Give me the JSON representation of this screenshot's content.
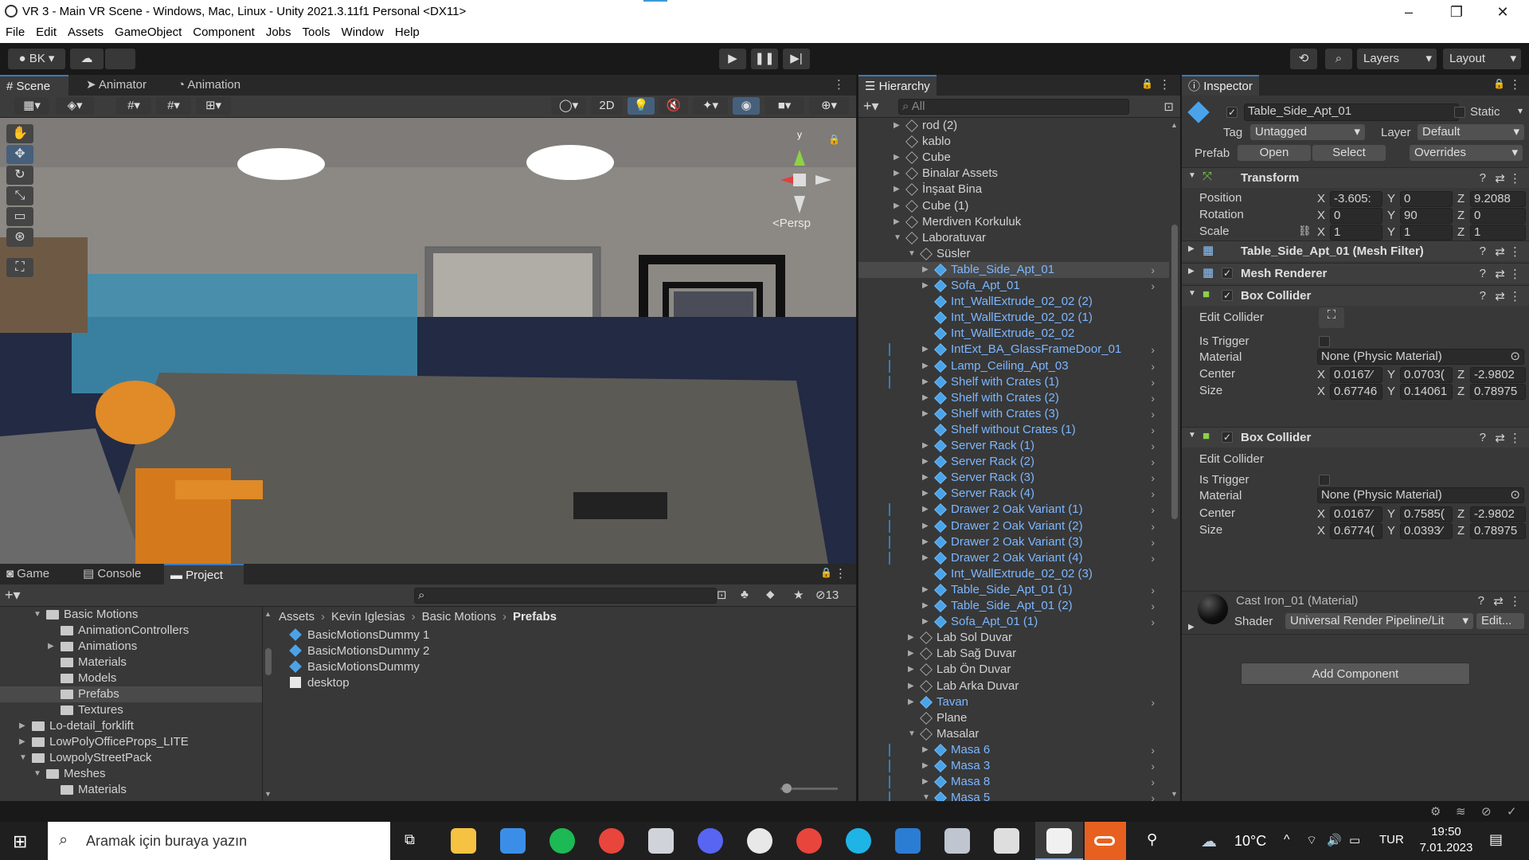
{
  "window": {
    "title": "VR 3 - Main VR Scene - Windows, Mac, Linux - Unity 2021.3.11f1 Personal <DX11>"
  },
  "menu": [
    "File",
    "Edit",
    "Assets",
    "GameObject",
    "Component",
    "Jobs",
    "Tools",
    "Window",
    "Help"
  ],
  "toolbar": {
    "account": "BK",
    "layers": "Layers",
    "layout": "Layout"
  },
  "scene_panel": {
    "tabs": [
      "Scene",
      "Animator",
      "Animation"
    ],
    "mode_2d": "2D",
    "persp_label": "<Persp",
    "gizmo_y": "y"
  },
  "hierarchy": {
    "tab": "Hierarchy",
    "search_placeholder": "All",
    "items": [
      {
        "label": "rod (2)",
        "color": "white",
        "indent": 0,
        "arrow": "right",
        "icon": "go",
        "child": false
      },
      {
        "label": "kablo",
        "color": "white",
        "indent": 0,
        "arrow": "none",
        "icon": "go",
        "child": false
      },
      {
        "label": "Cube",
        "color": "white",
        "indent": 0,
        "arrow": "right",
        "icon": "go",
        "child": false
      },
      {
        "label": "Binalar Assets",
        "color": "white",
        "indent": 0,
        "arrow": "right",
        "icon": "go",
        "child": false
      },
      {
        "label": "İnşaat Bina",
        "color": "white",
        "indent": 0,
        "arrow": "right",
        "icon": "go",
        "child": false
      },
      {
        "label": "Cube (1)",
        "color": "white",
        "indent": 0,
        "arrow": "right",
        "icon": "go",
        "child": false
      },
      {
        "label": "Merdiven Korkuluk",
        "color": "white",
        "indent": 0,
        "arrow": "right",
        "icon": "go",
        "child": false
      },
      {
        "label": "Laboratuvar",
        "color": "white",
        "indent": 0,
        "arrow": "down",
        "icon": "go",
        "child": false
      },
      {
        "label": "Süsler",
        "color": "white",
        "indent": 1,
        "arrow": "down",
        "icon": "go",
        "child": false
      },
      {
        "label": "Table_Side_Apt_01",
        "color": "blue",
        "indent": 2,
        "arrow": "right",
        "icon": "pf",
        "child": true,
        "selected": true
      },
      {
        "label": "Sofa_Apt_01",
        "color": "blue",
        "indent": 2,
        "arrow": "right",
        "icon": "pf",
        "child": true
      },
      {
        "label": "Int_WallExtrude_02_02 (2)",
        "color": "blue",
        "indent": 2,
        "arrow": "none",
        "icon": "pf",
        "child": false
      },
      {
        "label": "Int_WallExtrude_02_02 (1)",
        "color": "blue",
        "indent": 2,
        "arrow": "none",
        "icon": "pf",
        "child": false
      },
      {
        "label": "Int_WallExtrude_02_02",
        "color": "blue",
        "indent": 2,
        "arrow": "none",
        "icon": "pf",
        "child": false
      },
      {
        "label": "IntExt_BA_GlassFrameDoor_01",
        "color": "blue",
        "indent": 2,
        "arrow": "right",
        "icon": "pf",
        "child": true
      },
      {
        "label": "Lamp_Ceiling_Apt_03",
        "color": "blue",
        "indent": 2,
        "arrow": "right",
        "icon": "pf",
        "child": true
      },
      {
        "label": "Shelf with Crates (1)",
        "color": "blue",
        "indent": 2,
        "arrow": "right",
        "icon": "pf",
        "child": true
      },
      {
        "label": "Shelf with Crates (2)",
        "color": "blue",
        "indent": 2,
        "arrow": "right",
        "icon": "pf",
        "child": true
      },
      {
        "label": "Shelf with Crates (3)",
        "color": "blue",
        "indent": 2,
        "arrow": "right",
        "icon": "pf",
        "child": true
      },
      {
        "label": "Shelf without Crates (1)",
        "color": "blue",
        "indent": 2,
        "arrow": "none",
        "icon": "pf",
        "child": true
      },
      {
        "label": "Server Rack (1)",
        "color": "blue",
        "indent": 2,
        "arrow": "right",
        "icon": "pf",
        "child": true
      },
      {
        "label": "Server Rack (2)",
        "color": "blue",
        "indent": 2,
        "arrow": "right",
        "icon": "pf",
        "child": true
      },
      {
        "label": "Server Rack (3)",
        "color": "blue",
        "indent": 2,
        "arrow": "right",
        "icon": "pf",
        "child": true
      },
      {
        "label": "Server Rack (4)",
        "color": "blue",
        "indent": 2,
        "arrow": "right",
        "icon": "pf",
        "child": true
      },
      {
        "label": "Drawer 2 Oak Variant (1)",
        "color": "blue",
        "indent": 2,
        "arrow": "right",
        "icon": "pf",
        "child": true
      },
      {
        "label": "Drawer 2 Oak Variant (2)",
        "color": "blue",
        "indent": 2,
        "arrow": "right",
        "icon": "pf",
        "child": true
      },
      {
        "label": "Drawer 2 Oak Variant (3)",
        "color": "blue",
        "indent": 2,
        "arrow": "right",
        "icon": "pf",
        "child": true
      },
      {
        "label": "Drawer 2 Oak Variant (4)",
        "color": "blue",
        "indent": 2,
        "arrow": "right",
        "icon": "pf",
        "child": true
      },
      {
        "label": "Int_WallExtrude_02_02 (3)",
        "color": "blue",
        "indent": 2,
        "arrow": "none",
        "icon": "pf",
        "child": false
      },
      {
        "label": "Table_Side_Apt_01 (1)",
        "color": "blue",
        "indent": 2,
        "arrow": "right",
        "icon": "pf",
        "child": true
      },
      {
        "label": "Table_Side_Apt_01 (2)",
        "color": "blue",
        "indent": 2,
        "arrow": "right",
        "icon": "pf",
        "child": true
      },
      {
        "label": "Sofa_Apt_01 (1)",
        "color": "blue",
        "indent": 2,
        "arrow": "right",
        "icon": "pf",
        "child": true
      },
      {
        "label": "Lab Sol Duvar",
        "color": "white",
        "indent": 1,
        "arrow": "right",
        "icon": "go",
        "child": false
      },
      {
        "label": "Lab Sağ Duvar",
        "color": "white",
        "indent": 1,
        "arrow": "right",
        "icon": "go",
        "child": false
      },
      {
        "label": "Lab Ön Duvar",
        "color": "white",
        "indent": 1,
        "arrow": "right",
        "icon": "go",
        "child": false
      },
      {
        "label": "Lab Arka Duvar",
        "color": "white",
        "indent": 1,
        "arrow": "right",
        "icon": "go",
        "child": false
      },
      {
        "label": "Tavan",
        "color": "blue",
        "indent": 1,
        "arrow": "right",
        "icon": "pf",
        "child": true
      },
      {
        "label": "Plane",
        "color": "white",
        "indent": 1,
        "arrow": "none",
        "icon": "go",
        "child": false
      },
      {
        "label": "Masalar",
        "color": "white",
        "indent": 1,
        "arrow": "down",
        "icon": "go",
        "child": false
      },
      {
        "label": "Masa 6",
        "color": "blue",
        "indent": 2,
        "arrow": "right",
        "icon": "pf",
        "child": true
      },
      {
        "label": "Masa 3",
        "color": "blue",
        "indent": 2,
        "arrow": "right",
        "icon": "pf",
        "child": true
      },
      {
        "label": "Masa 8",
        "color": "blue",
        "indent": 2,
        "arrow": "right",
        "icon": "pf",
        "child": true
      },
      {
        "label": "Masa 5",
        "color": "blue",
        "indent": 2,
        "arrow": "down",
        "icon": "pf",
        "child": true
      }
    ]
  },
  "inspector": {
    "tab": "Inspector",
    "object_name": "Table_Side_Apt_01",
    "static_label": "Static",
    "tag_label": "Tag",
    "tag_value": "Untagged",
    "layer_label": "Layer",
    "layer_value": "Default",
    "prefab_label": "Prefab",
    "prefab_open": "Open",
    "prefab_select": "Select",
    "prefab_overrides": "Overrides",
    "transform": {
      "title": "Transform",
      "position_label": "Position",
      "rotation_label": "Rotation",
      "scale_label": "Scale",
      "position": [
        "-3.605:",
        "0",
        "9.2088"
      ],
      "rotation": [
        "0",
        "90",
        "0"
      ],
      "scale": [
        "1",
        "1",
        "1"
      ]
    },
    "mesh_filter_title": "Table_Side_Apt_01 (Mesh Filter)",
    "mesh_renderer_title": "Mesh Renderer",
    "box_collider_1": {
      "title": "Box Collider",
      "edit_collider": "Edit Collider",
      "is_trigger": "Is Trigger",
      "material_label": "Material",
      "material_value": "None (Physic Material)",
      "center_label": "Center",
      "size_label": "Size",
      "center": [
        "0.0167⁄",
        "0.0703(",
        "-2.9802"
      ],
      "size": [
        "0.67746",
        "0.14061",
        "0.78975"
      ]
    },
    "box_collider_2": {
      "title": "Box Collider",
      "edit_collider": "Edit Collider",
      "is_trigger": "Is Trigger",
      "material_label": "Material",
      "material_value": "None (Physic Material)",
      "center_label": "Center",
      "size_label": "Size",
      "center": [
        "0.0167⁄",
        "0.7585(",
        "-2.9802"
      ],
      "size": [
        "0.6774(",
        "0.0393⁄",
        "0.78975"
      ]
    },
    "material": {
      "name": "Cast Iron_01 (Material)",
      "shader_label": "Shader",
      "shader_value": "Universal Render Pipeline/Lit",
      "edit_label": "Edit..."
    },
    "add_component": "Add Component",
    "axis": [
      "X",
      "Y",
      "Z"
    ]
  },
  "project": {
    "tabs": [
      "Game",
      "Console",
      "Project"
    ],
    "hidden_count": "13",
    "breadcrumb": [
      "Assets",
      "Kevin Iglesias",
      "Basic Motions",
      "Prefabs"
    ],
    "tree": [
      {
        "label": "Basic Motions",
        "indent": 1,
        "arrow": "down"
      },
      {
        "label": "AnimationControllers",
        "indent": 2,
        "arrow": "none"
      },
      {
        "label": "Animations",
        "indent": 2,
        "arrow": "right"
      },
      {
        "label": "Materials",
        "indent": 2,
        "arrow": "none"
      },
      {
        "label": "Models",
        "indent": 2,
        "arrow": "none"
      },
      {
        "label": "Prefabs",
        "indent": 2,
        "arrow": "none",
        "selected": true
      },
      {
        "label": "Textures",
        "indent": 2,
        "arrow": "none"
      },
      {
        "label": "Lo-detail_forklift",
        "indent": 0,
        "arrow": "right"
      },
      {
        "label": "LowPolyOfficeProps_LITE",
        "indent": 0,
        "arrow": "right"
      },
      {
        "label": "LowpolyStreetPack",
        "indent": 0,
        "arrow": "down"
      },
      {
        "label": "Meshes",
        "indent": 1,
        "arrow": "down"
      },
      {
        "label": "Materials",
        "indent": 2,
        "arrow": "none"
      }
    ],
    "files": [
      {
        "label": "BasicMotionsDummy 1",
        "icon": "prefab"
      },
      {
        "label": "BasicMotionsDummy 2",
        "icon": "prefab"
      },
      {
        "label": "BasicMotionsDummy",
        "icon": "prefab"
      },
      {
        "label": "desktop",
        "icon": "file"
      }
    ]
  },
  "taskbar": {
    "search_placeholder": "Aramak için buraya yazın",
    "temperature": "10°C",
    "language": "TUR",
    "time": "19:50",
    "date": "7.01.2023"
  },
  "colors": {
    "accent": "#3a79bb",
    "prefab_blue": "#7cb7ff",
    "panel_bg": "#383838"
  }
}
